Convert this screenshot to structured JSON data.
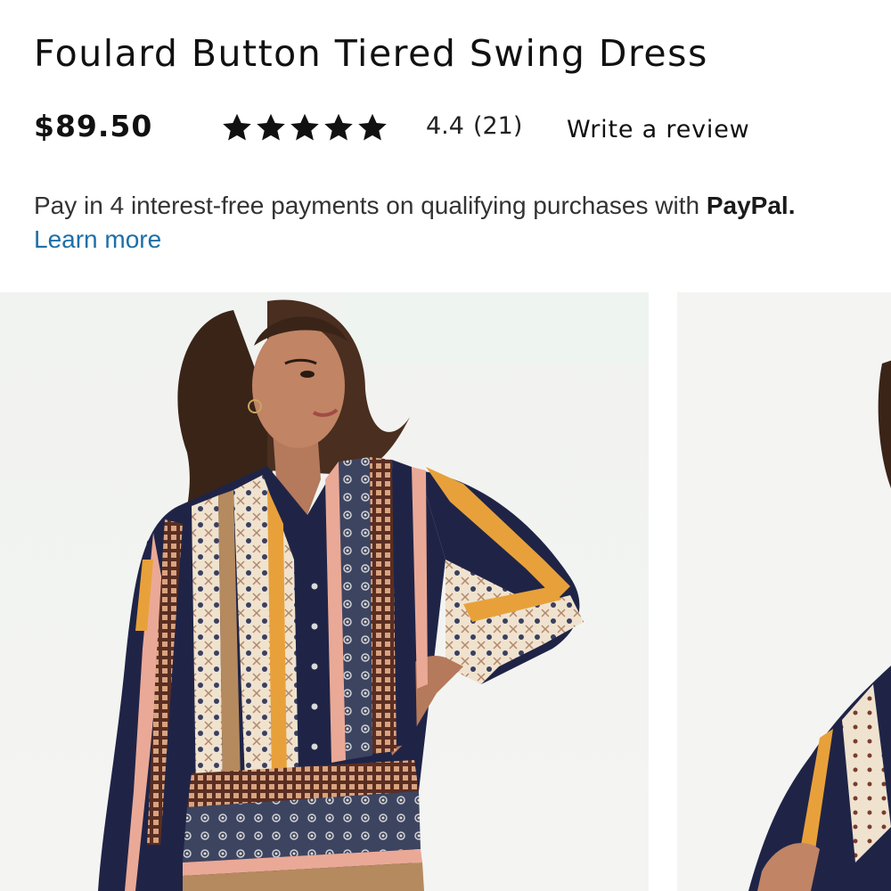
{
  "product": {
    "title": "Foulard Button Tiered Swing Dress",
    "price": "$89.50",
    "rating": {
      "value": "4.4",
      "count": "(21)",
      "stars": 5
    },
    "write_review_label": "Write a review"
  },
  "payment": {
    "message": "Pay in 4 interest-free payments on qualifying purchases with",
    "brand": "PayPal.",
    "learn_more_label": "Learn more"
  },
  "icons": {
    "star": "star-icon"
  },
  "colors": {
    "link": "#1d6fa8",
    "text": "#1a1a1a",
    "navy": "#1f2447",
    "mustard": "#e8a13a",
    "pink": "#eaa996",
    "cream": "#efe3cf"
  }
}
